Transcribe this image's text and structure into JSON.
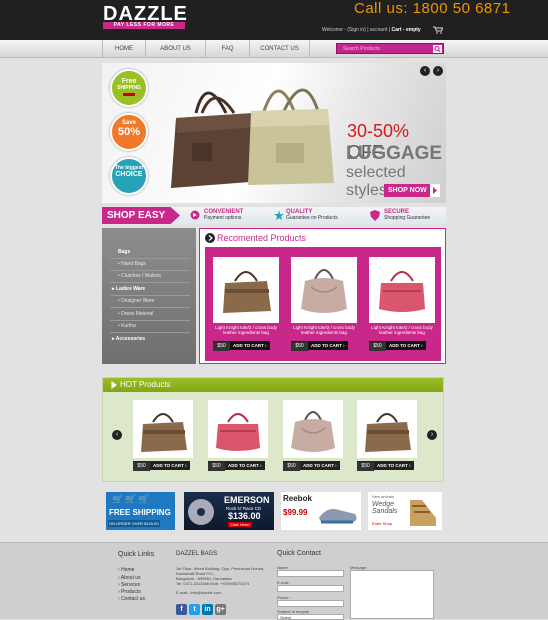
{
  "header": {
    "logo": "DAZZLE",
    "tagline": "PAY LESS FOR MORE",
    "call": "Call us: 1800 50 6871",
    "welcome": "Welcome",
    "signin": "(Sign in)",
    "sep": "|",
    "account": "account",
    "cart": "Cart - empty"
  },
  "nav": {
    "items": [
      "HOME",
      "ABOUT US",
      "FAQ",
      "CONTACT US"
    ],
    "search_placeholder": "Search Products"
  },
  "banner": {
    "badge1_a": "Free",
    "badge1_b": "SHIPPING",
    "badge2_a": "Save",
    "badge2_b": "50%",
    "badge3_a": "The biggest",
    "badge3_b": "CHOICE",
    "sale_pct": "30-50%",
    "sale_off": "OFF",
    "headline": "LUGGAGE",
    "sub": "selected styles",
    "cta": "SHOP NOW"
  },
  "strip": {
    "shopeasy": "SHOP EASY",
    "f1_t": "CONVENIENT",
    "f1_s": "Payment options",
    "f2_t": "QUALITY",
    "f2_s": "Guarantee on Products",
    "f3_t": "SECURE",
    "f3_s": "Shopping Guarantee"
  },
  "sidebar": {
    "items": [
      "Bags",
      "Hand Bags",
      "Clutches / Wallets",
      "Ladies Ware",
      "Designer Ware",
      "Dress Meterial",
      "Kurtha",
      "Accessories"
    ]
  },
  "recommended": {
    "title": "Recomented Products",
    "desc": "Light Knight tote/2 / cross body leather ingredients bag",
    "price": "$50",
    "add": "ADD TO CART"
  },
  "hot": {
    "title": "HOT Products",
    "price": "$50",
    "add": "ADD TO CART"
  },
  "ads": {
    "a1_t": "FREE SHIPPING",
    "a1_s": "ON ORDER OVER $100.00",
    "a2_t": "EMERSON",
    "a2_s": "Rock N' Race CD",
    "a2_p": "$136.00",
    "a2_c": "Click Here!",
    "a3_t": "Reebok",
    "a3_p": "$99.99",
    "a4_s": "New arrivals",
    "a4_t": "Wedge Sandals",
    "a4_c": "Enter Shop"
  },
  "footer": {
    "ql_title": "Quick Links",
    "links": [
      "Home",
      "About us",
      "Services",
      "Products",
      "Contact us"
    ],
    "addr_title": "DAZZEL BAGS",
    "addr": [
      "1st Floor, Weed Building, Opp. Peninsular Honda,",
      "Kachahalli Road P.O.,",
      "Bangalore - 695561, Karnataka",
      "Tel: 0471-2413366 Mob: +919995278274"
    ],
    "email": "E-mail : info@dazzle.com",
    "qc_title": "Quick Contact",
    "qc_name": "Name :",
    "qc_email": "E-mail :",
    "qc_phone": "Phone :",
    "qc_message": "Message :",
    "qc_subject": "Subject of enquiry",
    "qc_select": "Select"
  },
  "colors": {
    "accent": "#c8288a",
    "green": "#8bb11a",
    "dark": "#202020",
    "orange": "#f29400"
  }
}
